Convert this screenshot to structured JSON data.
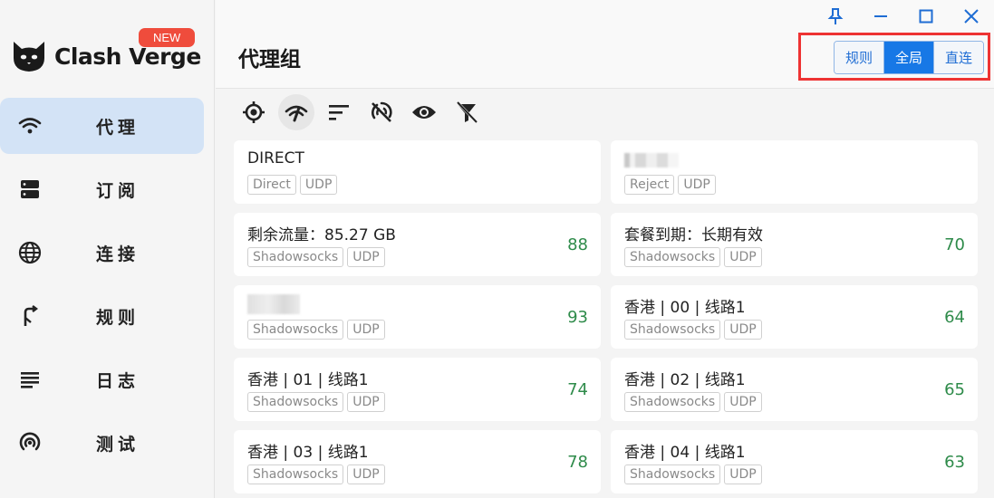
{
  "app": {
    "name": "Clash Verge",
    "new_badge": "NEW"
  },
  "window_controls": [
    "pin-icon",
    "minimize-icon",
    "maximize-icon",
    "close-icon"
  ],
  "nav": {
    "items": [
      {
        "label": "代理",
        "icon": "wifi-icon",
        "active": true
      },
      {
        "label": "订阅",
        "icon": "storage-icon",
        "active": false
      },
      {
        "label": "连接",
        "icon": "globe-icon",
        "active": false
      },
      {
        "label": "规则",
        "icon": "fork-icon",
        "active": false
      },
      {
        "label": "日志",
        "icon": "list-icon",
        "active": false
      },
      {
        "label": "测试",
        "icon": "signal-icon",
        "active": false
      }
    ]
  },
  "page": {
    "title": "代理组"
  },
  "mode": {
    "options": [
      "规则",
      "全局",
      "直连"
    ],
    "selected": "全局"
  },
  "toolbar": {
    "icons": [
      "locate-icon",
      "speed-test-icon",
      "sort-icon",
      "url-test-off-icon",
      "eye-icon",
      "filter-off-icon"
    ]
  },
  "proxies": [
    {
      "name": "DIRECT",
      "tags": [
        "Direct",
        "UDP"
      ],
      "delay": ""
    },
    {
      "name": "",
      "tags": [
        "Reject",
        "UDP"
      ],
      "delay": ""
    },
    {
      "name": "剩余流量：85.27 GB",
      "tags": [
        "Shadowsocks",
        "UDP"
      ],
      "delay": "88"
    },
    {
      "name": "套餐到期：长期有效",
      "tags": [
        "Shadowsocks",
        "UDP"
      ],
      "delay": "70"
    },
    {
      "name": "",
      "tags": [
        "Shadowsocks",
        "UDP"
      ],
      "delay": "93"
    },
    {
      "name": "香港 | 00 | 线路1",
      "tags": [
        "Shadowsocks",
        "UDP"
      ],
      "delay": "64"
    },
    {
      "name": "香港 | 01 | 线路1",
      "tags": [
        "Shadowsocks",
        "UDP"
      ],
      "delay": "74"
    },
    {
      "name": "香港 | 02 | 线路1",
      "tags": [
        "Shadowsocks",
        "UDP"
      ],
      "delay": "65"
    },
    {
      "name": "香港 | 03 | 线路1",
      "tags": [
        "Shadowsocks",
        "UDP"
      ],
      "delay": "78"
    },
    {
      "name": "香港 | 04 | 线路1",
      "tags": [
        "Shadowsocks",
        "UDP"
      ],
      "delay": "63"
    }
  ],
  "colors": {
    "accent": "#1778e6",
    "delay_good": "#2e8b4a",
    "nav_active_bg": "#d3e3f6",
    "new_badge": "#ef4c3c",
    "highlight_box": "#ee3333"
  }
}
